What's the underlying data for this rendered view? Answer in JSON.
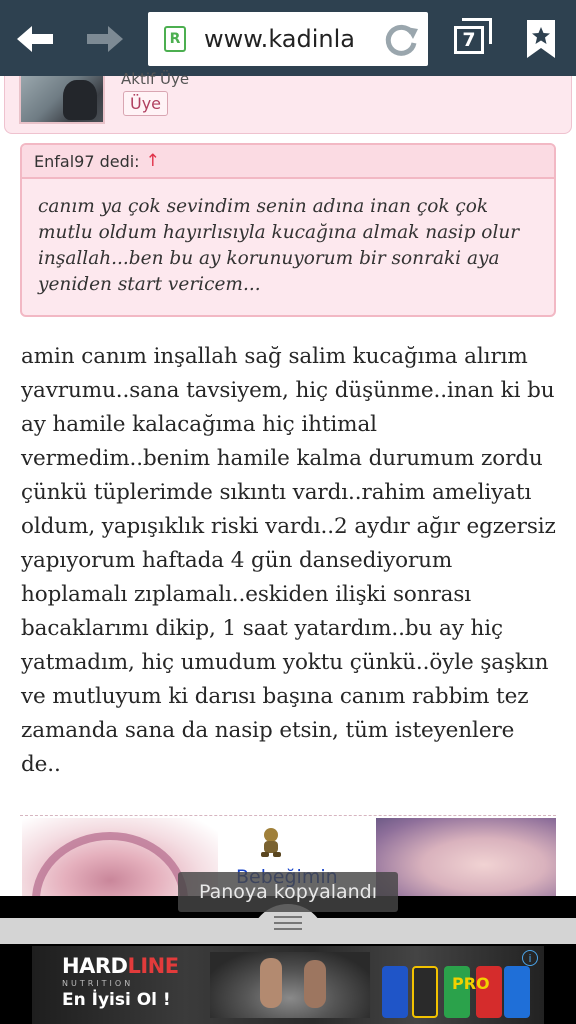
{
  "browser": {
    "url": "www.kadinla",
    "site_icon": "R",
    "tab_count": "7",
    "icons": [
      "back-arrow-icon",
      "forward-arrow-icon",
      "reload-icon",
      "tabs-icon",
      "bookmark-icon"
    ]
  },
  "member": {
    "status": "Aktif Üye",
    "role": "Üye"
  },
  "quote": {
    "author": "Enfal97 dedi:",
    "arrow": "↑",
    "text": "canım ya çok sevindim senin adına inan çok çok mutlu oldum hayırlısıyla kucağına almak nasip olur inşallah...ben bu ay korunuyorum bir sonraki aya yeniden start vericem..."
  },
  "post": {
    "text": "amin canım inşallah sağ salim kucağıma alırım yavrumu..sana tavsiyem, hiç düşünme..inan ki bu ay hamile kalacağıma hiç ihtimal vermedim..benim hamile kalma durumum zordu çünkü tüplerimde sıkıntı vardı..rahim ameliyatı oldum, yapışıklık riski vardı..2 aydır ağır egzersiz yapıyorum haftada 4 gün dansediyorum hoplamalı zıplamalı..eskiden ilişki sonrası bacaklarımı dikip, 1 saat yatardım..bu ay hiç yatmadım, hiç umudum yoktu çünkü..öyle şaşkın ve mutluyum ki darısı başına canım rabbim tez zamanda sana da nasip etsin, tüm isteyenlere de.."
  },
  "related": {
    "link_label": "Bebeğimin"
  },
  "toast": {
    "message": "Panoya kopyalandı"
  },
  "ad": {
    "brand_hard": "HARD",
    "brand_line": "LINE",
    "brand_sub": "NUTRITION",
    "tagline": "En İyisi Ol !",
    "product": "PRO",
    "info": "i"
  },
  "colors": {
    "toolbar": "#2e4150",
    "quote_background": "#fde8ee",
    "quote_border": "#f2b8c4",
    "link": "#1a44c8",
    "quote_arrow": "#e0334a"
  }
}
